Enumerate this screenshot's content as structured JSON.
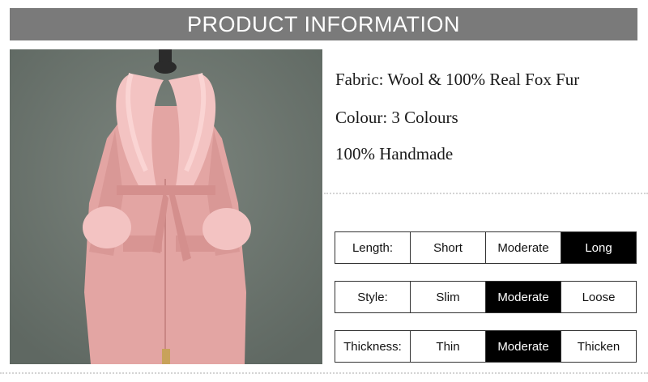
{
  "header": {
    "title": "PRODUCT INFORMATION"
  },
  "info": {
    "fabric": "Fabric: Wool & 100% Real Fox Fur",
    "colour": "Colour: 3 Colours",
    "handmade": "100% Handmade"
  },
  "specs": [
    {
      "label": "Length:",
      "options": [
        "Short",
        "Moderate",
        "Long"
      ],
      "selected": "Long"
    },
    {
      "label": "Style:",
      "options": [
        "Slim",
        "Moderate",
        "Loose"
      ],
      "selected": "Moderate"
    },
    {
      "label": "Thickness:",
      "options": [
        "Thin",
        "Moderate",
        "Thicken"
      ],
      "selected": "Moderate"
    }
  ],
  "colors": {
    "header_bg": "#7a7a7a",
    "coat_pink": "#e7a9a7",
    "fur_pink": "#f4c4c3",
    "selected_bg": "#000000"
  }
}
